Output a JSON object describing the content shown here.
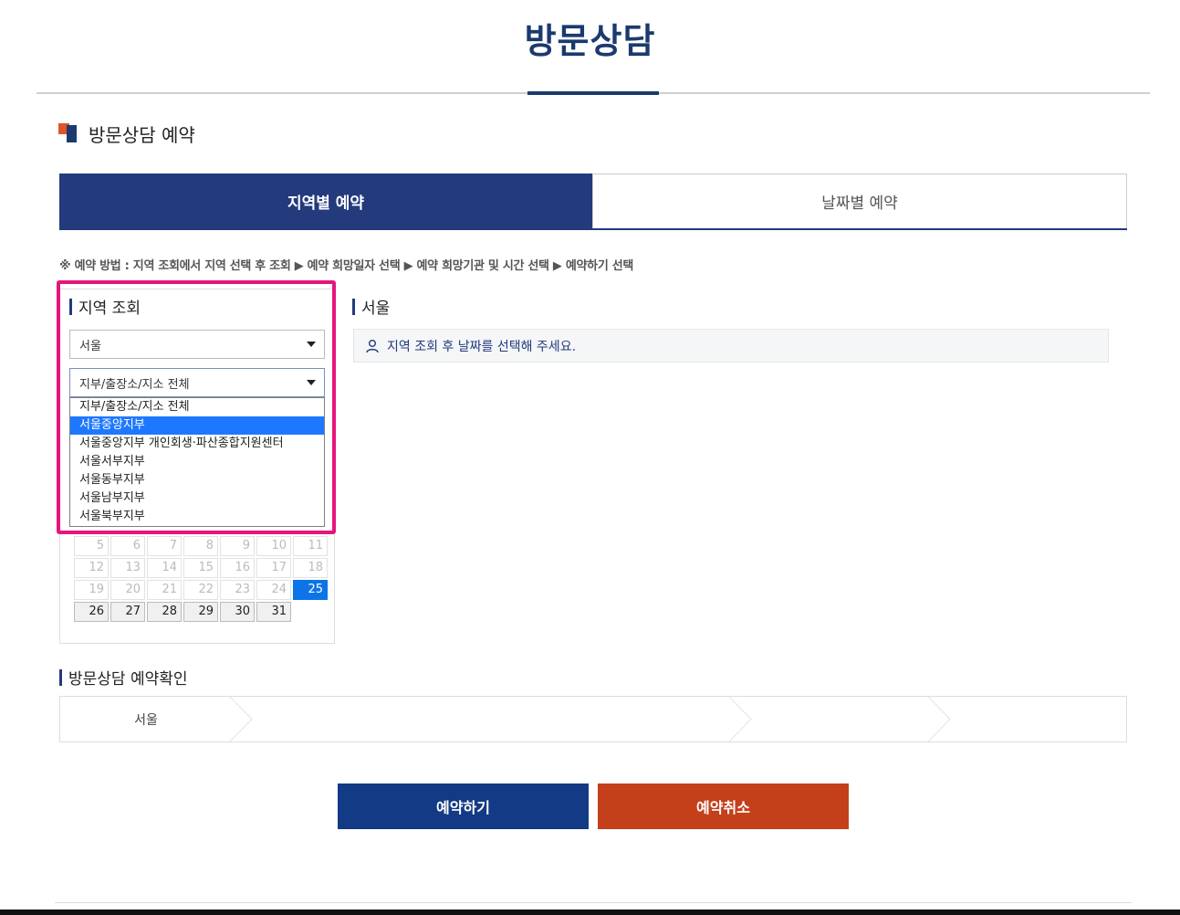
{
  "page": {
    "title": "방문상담"
  },
  "section": {
    "title": "방문상담 예약"
  },
  "tabs": [
    {
      "label": "지역별 예약",
      "active": true
    },
    {
      "label": "날짜별 예약",
      "active": false
    }
  ],
  "steps_text": "※ 예약 방법 : 지역 조회에서 지역 선택 후 조회 ▶ 예약 희망일자 선택 ▶ 예약 희망기관 및 시간 선택 ▶ 예약하기 선택",
  "region_lookup": {
    "title": "지역 조회",
    "region_select": {
      "value": "서울"
    },
    "branch_select": {
      "value": "지부/출장소/지소 전체"
    },
    "branch_options": [
      {
        "label": "지부/출장소/지소 전체",
        "selected": false
      },
      {
        "label": "서울중앙지부",
        "selected": true
      },
      {
        "label": "서울중앙지부 개인회생·파산종합지원센터",
        "selected": false
      },
      {
        "label": "서울서부지부",
        "selected": false
      },
      {
        "label": "서울동부지부",
        "selected": false
      },
      {
        "label": "서울남부지부",
        "selected": false
      },
      {
        "label": "서울북부지부",
        "selected": false
      }
    ]
  },
  "calendar": {
    "weeks": [
      [
        {
          "d": "5",
          "s": "off"
        },
        {
          "d": "6",
          "s": "off"
        },
        {
          "d": "7",
          "s": "off"
        },
        {
          "d": "8",
          "s": "off"
        },
        {
          "d": "9",
          "s": "off"
        },
        {
          "d": "10",
          "s": "off"
        },
        {
          "d": "11",
          "s": "off"
        }
      ],
      [
        {
          "d": "12",
          "s": "off"
        },
        {
          "d": "13",
          "s": "off"
        },
        {
          "d": "14",
          "s": "off"
        },
        {
          "d": "15",
          "s": "off"
        },
        {
          "d": "16",
          "s": "off"
        },
        {
          "d": "17",
          "s": "off"
        },
        {
          "d": "18",
          "s": "off"
        }
      ],
      [
        {
          "d": "19",
          "s": "off"
        },
        {
          "d": "20",
          "s": "off"
        },
        {
          "d": "21",
          "s": "off"
        },
        {
          "d": "22",
          "s": "off"
        },
        {
          "d": "23",
          "s": "off"
        },
        {
          "d": "24",
          "s": "off"
        },
        {
          "d": "25",
          "s": "today"
        }
      ],
      [
        {
          "d": "26",
          "s": "on"
        },
        {
          "d": "27",
          "s": "on"
        },
        {
          "d": "28",
          "s": "on"
        },
        {
          "d": "29",
          "s": "on"
        },
        {
          "d": "30",
          "s": "on"
        },
        {
          "d": "31",
          "s": "on"
        },
        {
          "d": "",
          "s": "empty"
        }
      ]
    ]
  },
  "result": {
    "title": "서울",
    "notice": "지역 조회 후 날짜를 선택해 주세요.",
    "notice_icon": "person-icon"
  },
  "confirm": {
    "title": "방문상담 예약확인",
    "region": "서울"
  },
  "buttons": {
    "reserve": "예약하기",
    "cancel": "예약취소"
  },
  "colors": {
    "navy": "#233a7c",
    "title_navy": "#1b3a6e",
    "reserve_btn": "#133a84",
    "cancel_btn": "#c3401b",
    "highlight": "#e6157d",
    "selected_option": "#1e78ff",
    "today": "#0c74e8"
  }
}
